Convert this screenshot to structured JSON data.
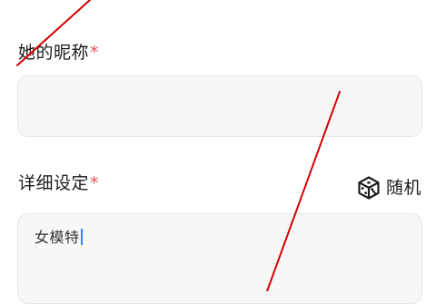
{
  "form": {
    "nickname": {
      "label": "她的昵称",
      "required_mark": "*",
      "value": ""
    },
    "details": {
      "label": "详细设定",
      "required_mark": "*",
      "value": "女模特"
    },
    "random_button": {
      "label": "随机",
      "icon": "dice-icon"
    }
  },
  "colors": {
    "required": "#e8505b",
    "field_background": "#f7f7f8",
    "caret": "#3b7cff",
    "annotation_stroke": "#d40000"
  }
}
